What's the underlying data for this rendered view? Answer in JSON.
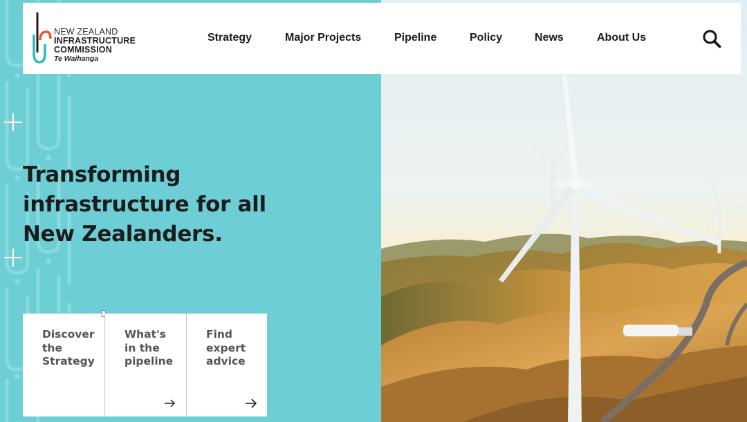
{
  "brand": {
    "line1": "NEW ZEALAND",
    "line2": "INFRASTRUCTURE",
    "line3": "COMMISSION",
    "line4": "Te Waihanga"
  },
  "nav": {
    "items": [
      {
        "label": "Strategy"
      },
      {
        "label": "Major Projects"
      },
      {
        "label": "Pipeline"
      },
      {
        "label": "Policy"
      },
      {
        "label": "News"
      },
      {
        "label": "About Us"
      }
    ]
  },
  "hero": {
    "line1": "Transforming",
    "line2": "infrastructure for all",
    "line3": "New Zealanders."
  },
  "cards": [
    {
      "line1": "Discover",
      "line2": "the",
      "line3": "Strategy"
    },
    {
      "line1": "What's",
      "line2": "in the",
      "line3": "pipeline"
    },
    {
      "line1": "Find",
      "line2": "expert",
      "line3": "advice"
    }
  ],
  "colors": {
    "teal": "#6dcfd5",
    "logo_teal": "#2fb7bf",
    "logo_orange": "#f05a28",
    "text_dark": "#1c1c1c"
  },
  "icons": {
    "search": "search-icon",
    "arrow": "arrow-right-icon"
  }
}
